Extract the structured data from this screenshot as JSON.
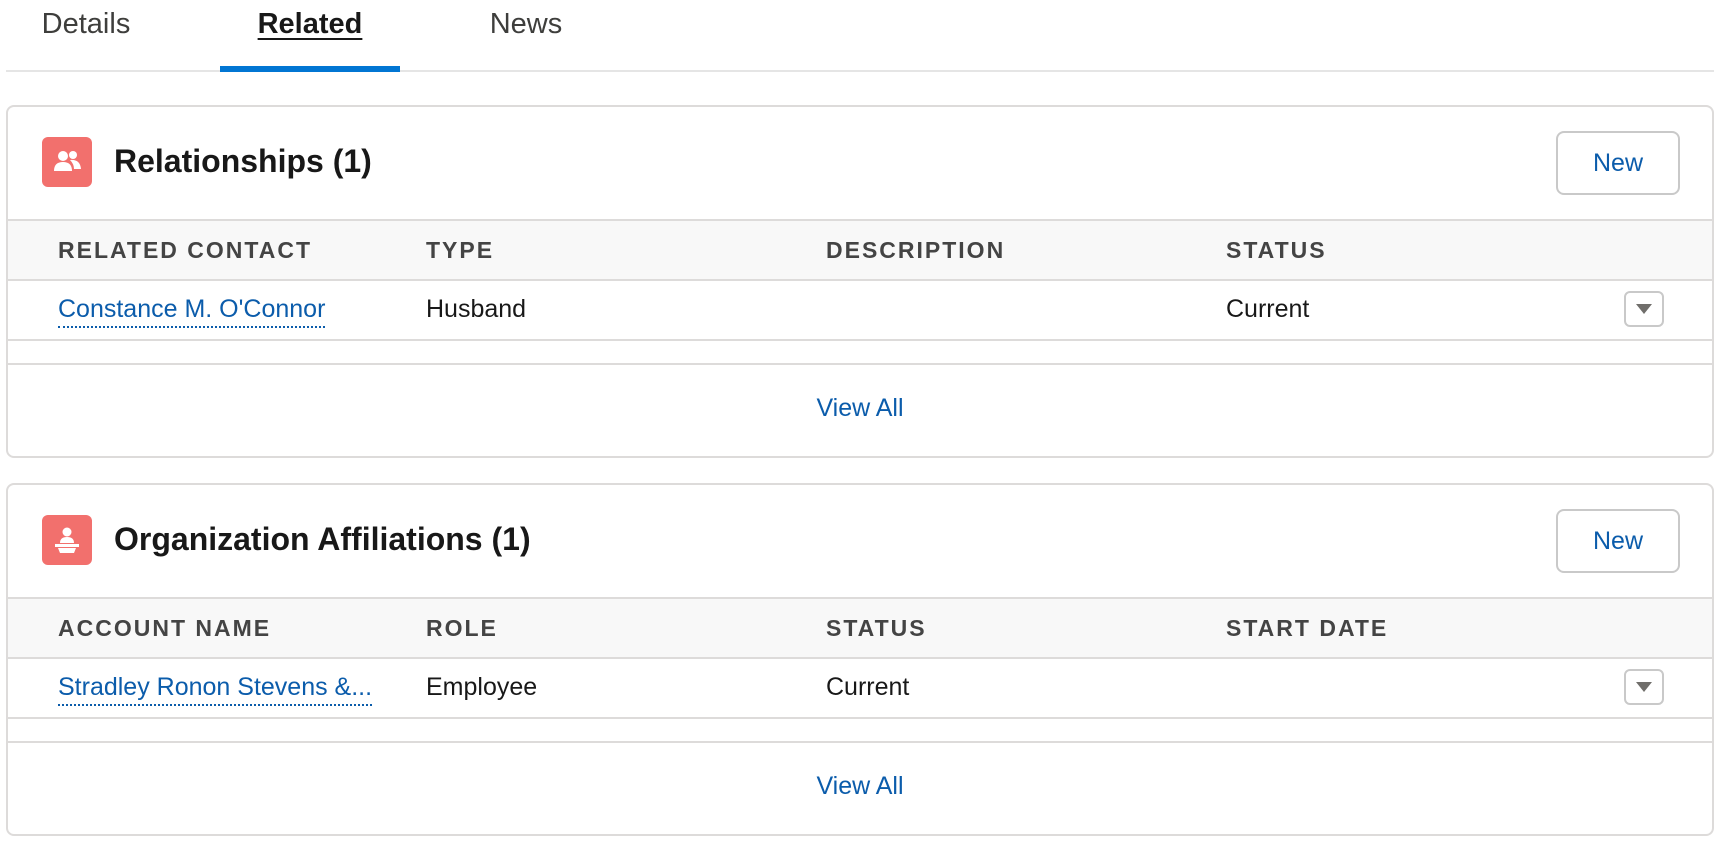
{
  "tabs": [
    {
      "label": "Details",
      "active": false
    },
    {
      "label": "Related",
      "active": true
    },
    {
      "label": "News",
      "active": false
    }
  ],
  "relationships": {
    "title": "Relationships (1)",
    "icon": "relationship-icon",
    "new_label": "New",
    "columns": [
      "RELATED CONTACT",
      "TYPE",
      "DESCRIPTION",
      "STATUS"
    ],
    "rows": [
      {
        "related_contact": "Constance M. O'Connor",
        "type": "Husband",
        "description": "",
        "status": "Current"
      }
    ],
    "view_all_label": "View All"
  },
  "affiliations": {
    "title": "Organization Affiliations (1)",
    "icon": "affiliation-icon",
    "new_label": "New",
    "columns": [
      "ACCOUNT NAME",
      "ROLE",
      "STATUS",
      "START DATE"
    ],
    "rows": [
      {
        "account_name": "Stradley Ronon Stevens &...",
        "role": "Employee",
        "status": "Current",
        "start_date": ""
      }
    ],
    "view_all_label": "View All"
  },
  "colors": {
    "accent": "#0176d3",
    "link": "#0b5cab",
    "icon_bg": "#f2706d",
    "border": "#dddbda",
    "header_bg": "#f8f8f8"
  }
}
